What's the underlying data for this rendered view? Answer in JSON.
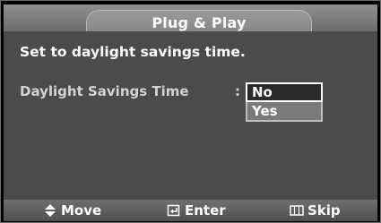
{
  "title": "Plug & Play",
  "prompt": "Set to daylight savings time.",
  "setting": {
    "label": "Daylight Savings Time",
    "colon": ":",
    "options": [
      {
        "label": "No",
        "selected": true
      },
      {
        "label": "Yes",
        "selected": false
      }
    ]
  },
  "footer": {
    "move": {
      "icon": "up-down-arrow-icon",
      "label": "Move"
    },
    "enter": {
      "icon": "enter-icon",
      "label": "Enter"
    },
    "skip": {
      "icon": "menu-icon",
      "label": "Skip"
    }
  }
}
